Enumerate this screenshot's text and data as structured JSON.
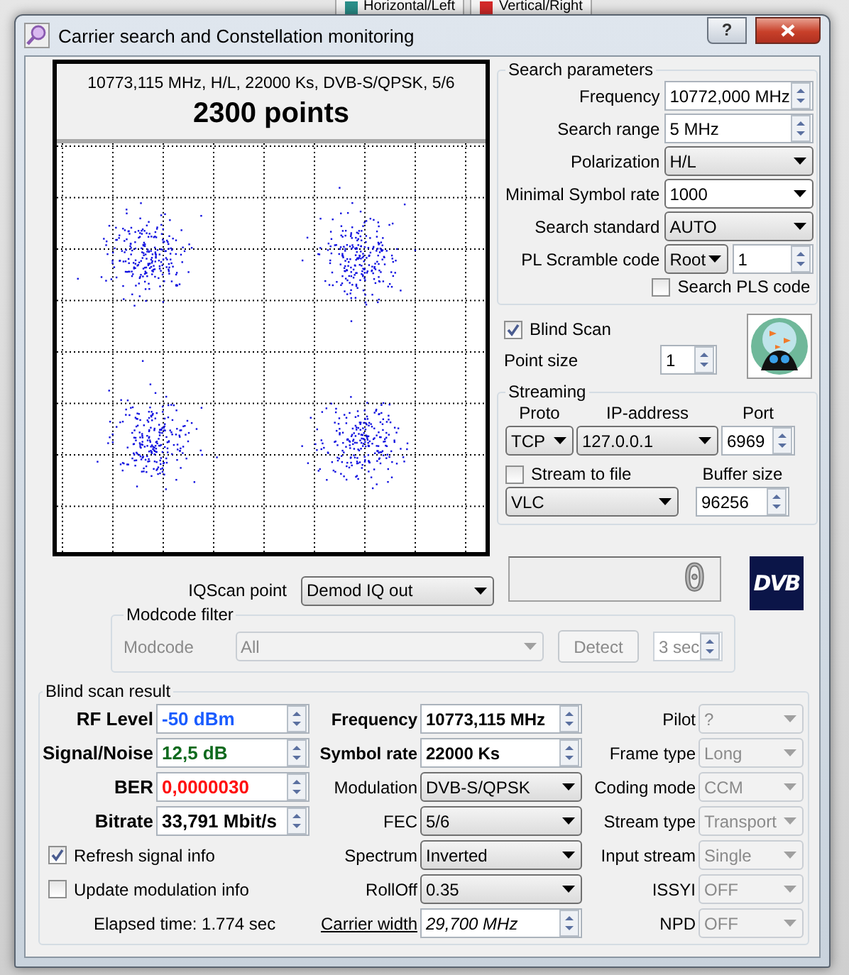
{
  "background": {
    "legend": [
      {
        "label": "Horizontal/Left",
        "color": "#2a8f8a"
      },
      {
        "label": "Vertical/Right",
        "color": "#d42a2a"
      }
    ]
  },
  "window": {
    "title": "Carrier search and Constellation monitoring",
    "help": "?"
  },
  "constellation": {
    "caption": "10773,115 MHz, H/L, 22000 Ks, DVB-S/QPSK, 5/6",
    "points": "2300 points"
  },
  "search_parameters": {
    "title": "Search parameters",
    "fields": [
      {
        "kind": "spin",
        "label": "Frequency",
        "value": "10772,000 MHz"
      },
      {
        "kind": "spin",
        "label": "Search range",
        "value": "5 MHz"
      },
      {
        "kind": "combo",
        "label": "Polarization",
        "value": "H/L"
      },
      {
        "kind": "edit",
        "label": "Minimal Symbol rate",
        "value": "1000"
      },
      {
        "kind": "combo",
        "label": "Search standard",
        "value": "AUTO"
      },
      {
        "kind": "pls",
        "label": "PL Scramble code",
        "value": "Root",
        "number": "1"
      }
    ],
    "search_pls": {
      "label": "Search PLS code",
      "checked": false
    }
  },
  "blind_scan": {
    "label": "Blind Scan",
    "checked": true
  },
  "point_size": {
    "label": "Point size",
    "value": "1"
  },
  "streaming": {
    "title": "Streaming",
    "proto_label": "Proto",
    "proto": "TCP",
    "ip_label": "IP-address",
    "ip": "127.0.0.1",
    "port_label": "Port",
    "port": "6969",
    "stream_to_file": {
      "label": "Stream to file",
      "checked": false
    },
    "player": "VLC",
    "buffer_label": "Buffer size",
    "buffer": "96256"
  },
  "iqscan": {
    "label": "IQScan point",
    "value": "Demod IQ out"
  },
  "counter": "0",
  "logo": "DVB",
  "modcode_filter": {
    "title": "Modcode filter",
    "disabled": true,
    "label": "Modcode",
    "value": "All",
    "detect": "Detect",
    "time": "3 sec"
  },
  "result": {
    "title": "Blind scan result",
    "signal": [
      {
        "label": "RF Level",
        "value": "-50 dBm",
        "color": "#1a5cff"
      },
      {
        "label": "Signal/Noise",
        "value": "12,5 dB",
        "color": "#0f6a1e"
      },
      {
        "label": "BER",
        "value": "0,0000030",
        "color": "#ff1010"
      },
      {
        "label": "Bitrate",
        "value": "33,791 Mbit/s",
        "color": "#000000"
      }
    ],
    "refresh": {
      "label": "Refresh signal info",
      "checked": true
    },
    "update": {
      "label": "Update modulation info",
      "checked": false
    },
    "elapsed": "Elapsed time: 1.774 sec",
    "modulation": [
      {
        "kind": "bold",
        "label": "Frequency",
        "value": "10773,115 MHz"
      },
      {
        "kind": "bold",
        "label": "Symbol rate",
        "value": "22000 Ks"
      },
      {
        "kind": "combo",
        "label": "Modulation",
        "value": "DVB-S/QPSK"
      },
      {
        "kind": "combo",
        "label": "FEC",
        "value": "5/6"
      },
      {
        "kind": "combo",
        "label": "Spectrum",
        "value": "Inverted"
      },
      {
        "kind": "combo",
        "label": "RollOff",
        "value": "0.35"
      },
      {
        "kind": "link",
        "label": "Carrier width",
        "value": "29,700 MHz"
      }
    ],
    "stream": [
      {
        "label": "Pilot",
        "value": "?",
        "disabled": true
      },
      {
        "label": "Frame type",
        "value": "Long",
        "disabled": true
      },
      {
        "label": "Coding mode",
        "value": "CCM",
        "disabled": true
      },
      {
        "label": "Stream type",
        "value": "Transport",
        "disabled": true
      },
      {
        "label": "Input stream",
        "value": "Single",
        "disabled": true
      },
      {
        "label": "ISSYI",
        "value": "OFF",
        "disabled": true
      },
      {
        "label": "NPD",
        "value": "OFF",
        "disabled": true
      }
    ]
  }
}
